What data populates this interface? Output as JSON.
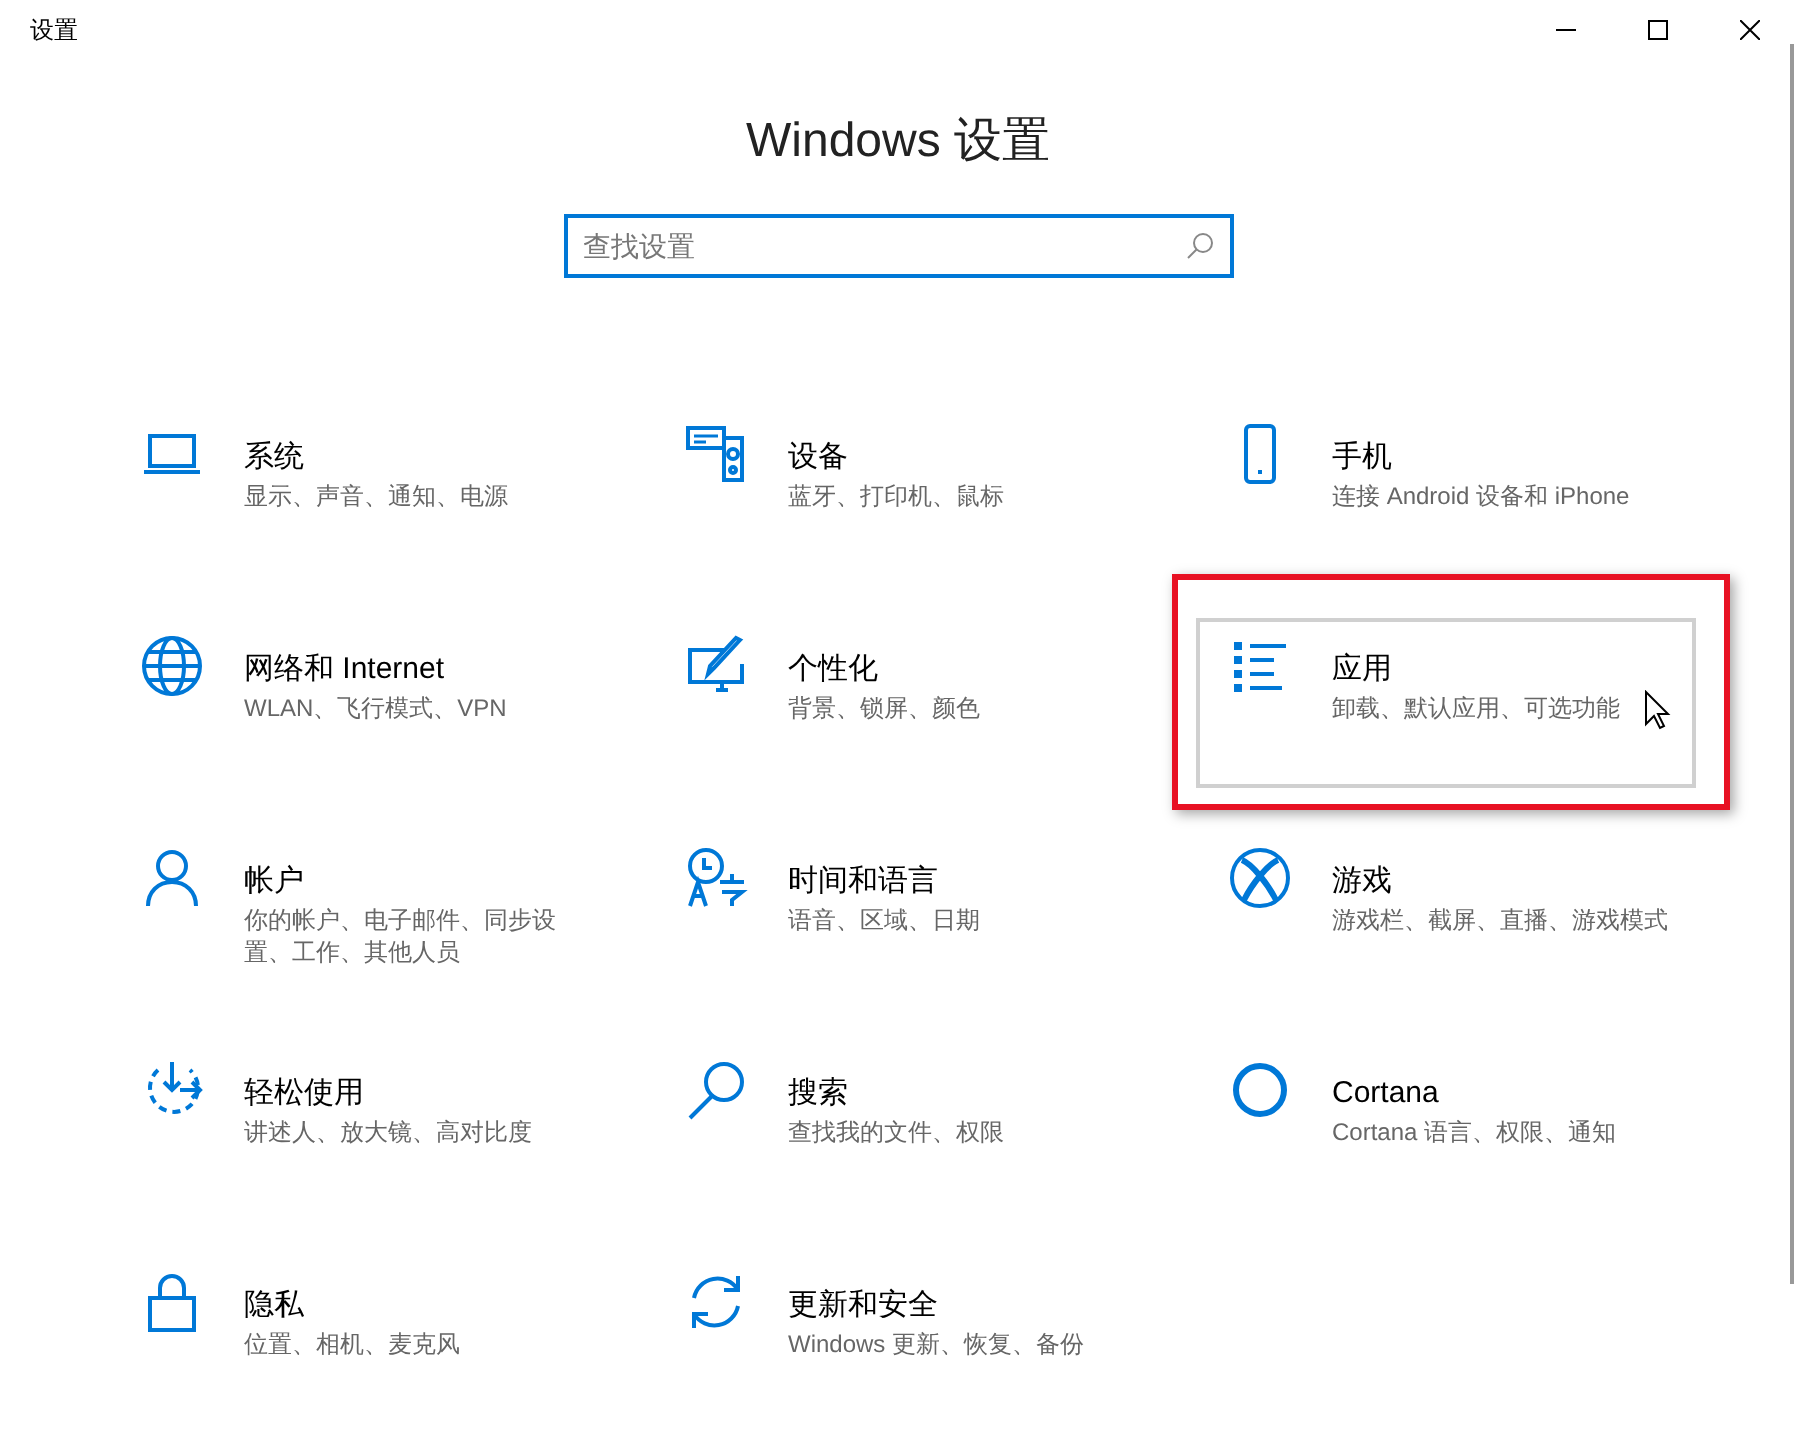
{
  "window": {
    "title": "设置"
  },
  "heading": "Windows 设置",
  "search": {
    "placeholder": "查找设置"
  },
  "tiles": [
    {
      "title": "系统",
      "description": [
        "显示、声音、通知、电源"
      ],
      "hovered": false,
      "highlighted": false
    },
    {
      "title": "设备",
      "description": [
        "蓝牙、打印机、鼠标"
      ],
      "hovered": false,
      "highlighted": false
    },
    {
      "title": "手机",
      "description": [
        "连接 Android 设备和 iPhone"
      ],
      "hovered": false,
      "highlighted": false
    },
    {
      "title": "网络和 Internet",
      "description": [
        "WLAN、飞行模式、VPN"
      ],
      "hovered": false,
      "highlighted": false
    },
    {
      "title": "个性化",
      "description": [
        "背景、锁屏、颜色"
      ],
      "hovered": false,
      "highlighted": false
    },
    {
      "title": "应用",
      "description": [
        "卸载、默认应用、可选功能"
      ],
      "hovered": true,
      "highlighted": true
    },
    {
      "title": "帐户",
      "description": [
        "你的帐户、电子邮件、同步设",
        "置、工作、其他人员"
      ],
      "hovered": false,
      "highlighted": false
    },
    {
      "title": "时间和语言",
      "description": [
        "语音、区域、日期"
      ],
      "hovered": false,
      "highlighted": false
    },
    {
      "title": "游戏",
      "description": [
        "游戏栏、截屏、直播、游戏模式"
      ],
      "hovered": false,
      "highlighted": false
    },
    {
      "title": "轻松使用",
      "description": [
        "讲述人、放大镜、高对比度"
      ],
      "hovered": false,
      "highlighted": false
    },
    {
      "title": "搜索",
      "description": [
        "查找我的文件、权限"
      ],
      "hovered": false,
      "highlighted": false
    },
    {
      "title": "Cortana",
      "description": [
        "Cortana 语言、权限、通知"
      ],
      "hovered": false,
      "highlighted": false
    },
    {
      "title": "隐私",
      "description": [
        "位置、相机、麦克风"
      ],
      "hovered": false,
      "highlighted": false
    },
    {
      "title": "更新和安全",
      "description": [
        "Windows 更新、恢复、备份"
      ],
      "hovered": false,
      "highlighted": false
    }
  ]
}
